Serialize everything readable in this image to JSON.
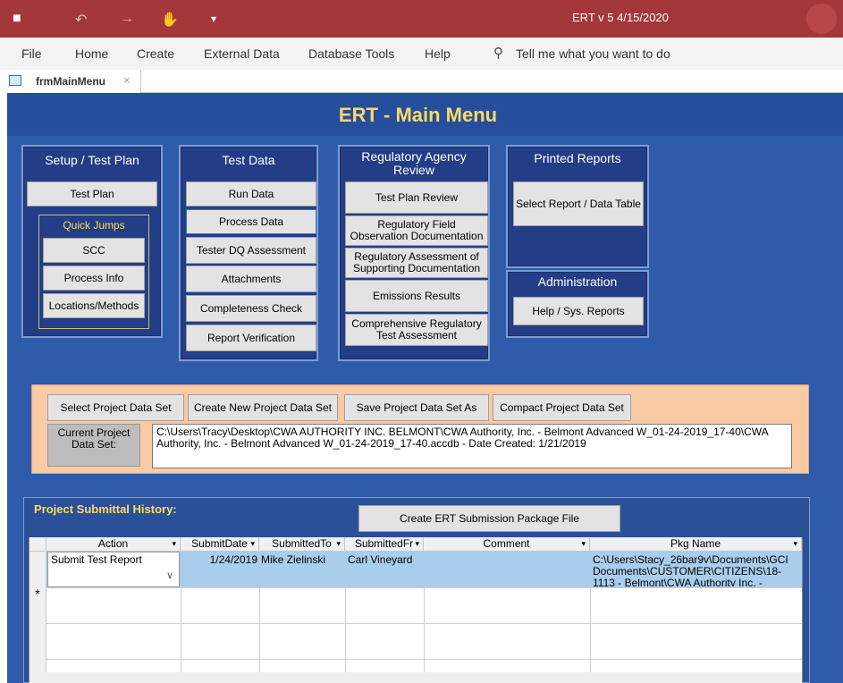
{
  "titlebar": {
    "title": "ERT v 5  4/15/2020",
    "save_icon": "■",
    "undo_icon": "↶",
    "redo_icon": "→",
    "touch_icon": "✋",
    "customize_icon": "▾"
  },
  "menu": {
    "file": "File",
    "home": "Home",
    "create": "Create",
    "external": "External Data",
    "dbtools": "Database Tools",
    "help": "Help",
    "tell_me": "Tell me what you want to do"
  },
  "doctab": {
    "label": "frmMainMenu",
    "close": "×"
  },
  "form": {
    "title": "ERT - Main Menu",
    "setup": {
      "title": "Setup / Test Plan",
      "test_plan": "Test Plan",
      "quick_jumps": "Quick Jumps",
      "scc": "SCC",
      "process_info": "Process Info",
      "locations": "Locations/Methods"
    },
    "testdata": {
      "title": "Test Data",
      "run_data": "Run Data",
      "process_data": "Process Data",
      "tester_dq": "Tester DQ Assessment",
      "attachments": "Attachments",
      "completeness": "Completeness Check",
      "report_verification": "Report Verification"
    },
    "regulatory": {
      "title": "Regulatory Agency Review",
      "test_plan_review": "Test Plan Review",
      "field_obs": "Regulatory Field Observation Documentation",
      "assessment_supporting": "Regulatory Assessment of Supporting Documentation",
      "emissions": "Emissions Results",
      "comprehensive": "Comprehensive Regulatory Test Assessment"
    },
    "printed": {
      "title": "Printed Reports",
      "select_report": "Select Report / Data Table"
    },
    "admin": {
      "title": "Administration",
      "help_sys": "Help / Sys. Reports"
    },
    "project": {
      "select": "Select Project Data Set",
      "create": "Create New Project Data Set",
      "save_as": "Save Project Data Set As",
      "compact": "Compact Project Data Set",
      "current_label": "Current Project Data Set:",
      "current_value": "C:\\Users\\Tracy\\Desktop\\CWA AUTHORITY INC. BELMONT\\CWA Authority, Inc. - Belmont Advanced W_01-24-2019_17-40\\CWA Authority, Inc. - Belmont Advanced W_01-24-2019_17-40.accdb - Date Created: 1/21/2019"
    },
    "history": {
      "title": "Project Submittal History:",
      "create_pkg": "Create ERT Submission Package File",
      "columns": [
        "Action",
        "SubmitDate",
        "SubmittedTo",
        "SubmittedFr",
        "Comment",
        "Pkg Name"
      ],
      "row": {
        "action": "Submit Test Report",
        "submit_date": "1/24/2019",
        "submitted_to": "Mike Zielinski",
        "submitted_from": "Carl Vineyard",
        "comment": "",
        "pkg_name": "C:\\Users\\Stacy_26bar9v\\Documents\\GCI Documents\\CUSTOMER\\CITIZENS\\18-1113 - Belmont\\CWA Authority Inc. -"
      },
      "new_record_marker": "*",
      "dropdown_glyph": "∨",
      "sort_glyph": "▾"
    }
  }
}
